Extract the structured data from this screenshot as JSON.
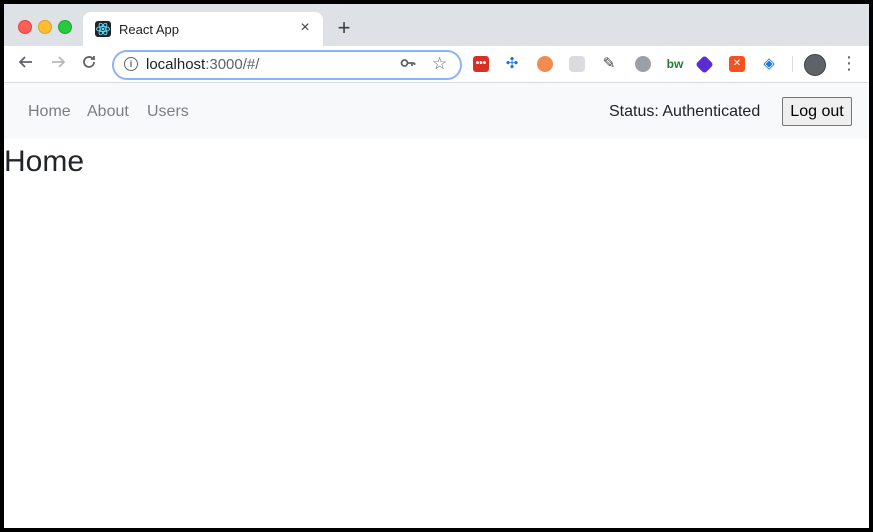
{
  "browser": {
    "tab": {
      "title": "React App",
      "close": "×"
    },
    "new_tab": "+",
    "address": {
      "host": "localhost",
      "path": ":3000/#/"
    },
    "extensions": {
      "e1": "•••",
      "e2": "✣",
      "e5": "✎",
      "e7": "bw",
      "e9": "✕",
      "e10": "◈"
    }
  },
  "app": {
    "nav": {
      "home": "Home",
      "about": "About",
      "users": "Users"
    },
    "status": "Status: Authenticated",
    "logout_label": "Log out",
    "page_title": "Home"
  }
}
